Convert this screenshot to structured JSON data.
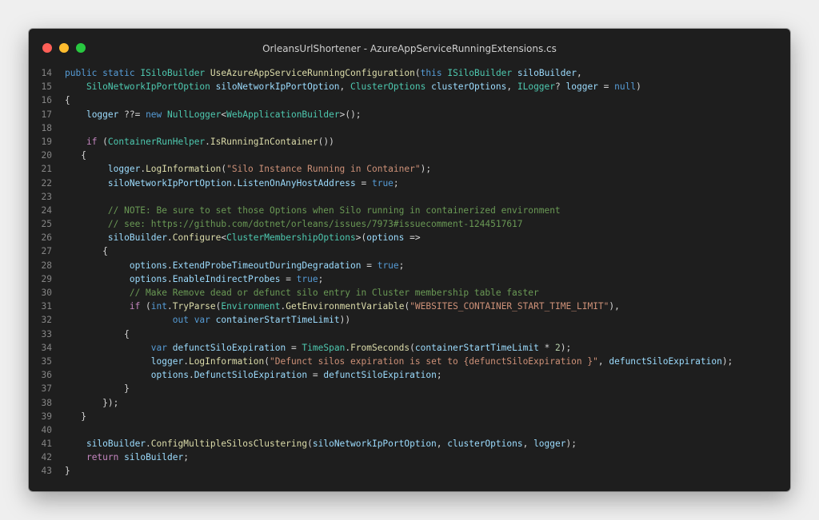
{
  "window": {
    "title": "OrleansUrlShortener - AzureAppServiceRunningExtensions.cs",
    "traffic_lights": [
      {
        "name": "close",
        "color": "#ff5f57"
      },
      {
        "name": "minimize",
        "color": "#febc2e"
      },
      {
        "name": "maximize",
        "color": "#28c840"
      }
    ]
  },
  "editor": {
    "colors": {
      "keyword": "#569cd6",
      "control": "#c586c0",
      "type": "#4ec9b0",
      "method": "#dcdcaa",
      "variable": "#9cdcfe",
      "string": "#ce9178",
      "comment": "#6a9955",
      "number": "#b5cea8",
      "plain": "#d4d4d4",
      "line_number": "#858585"
    },
    "lines": [
      {
        "num": "14",
        "tokens": [
          [
            "public",
            "keyword"
          ],
          [
            " ",
            "plain"
          ],
          [
            "static",
            "keyword"
          ],
          [
            " ",
            "plain"
          ],
          [
            "ISiloBuilder",
            "type"
          ],
          [
            " ",
            "plain"
          ],
          [
            "UseAzureAppServiceRunningConfiguration",
            "method"
          ],
          [
            "(",
            "plain"
          ],
          [
            "this",
            "keyword"
          ],
          [
            " ",
            "plain"
          ],
          [
            "ISiloBuilder",
            "type"
          ],
          [
            " ",
            "plain"
          ],
          [
            "siloBuilder",
            "variable"
          ],
          [
            ",",
            "plain"
          ]
        ]
      },
      {
        "num": "15",
        "tokens": [
          [
            "    ",
            "plain"
          ],
          [
            "SiloNetworkIpPortOption",
            "type"
          ],
          [
            " ",
            "plain"
          ],
          [
            "siloNetworkIpPortOption",
            "variable"
          ],
          [
            ", ",
            "plain"
          ],
          [
            "ClusterOptions",
            "type"
          ],
          [
            " ",
            "plain"
          ],
          [
            "clusterOptions",
            "variable"
          ],
          [
            ", ",
            "plain"
          ],
          [
            "ILogger",
            "type"
          ],
          [
            "? ",
            "plain"
          ],
          [
            "logger",
            "variable"
          ],
          [
            " = ",
            "plain"
          ],
          [
            "null",
            "keyword"
          ],
          [
            ")",
            "plain"
          ]
        ]
      },
      {
        "num": "16",
        "tokens": [
          [
            "{",
            "plain"
          ]
        ]
      },
      {
        "num": "17",
        "tokens": [
          [
            "    ",
            "plain"
          ],
          [
            "logger",
            "variable"
          ],
          [
            " ??= ",
            "plain"
          ],
          [
            "new",
            "keyword"
          ],
          [
            " ",
            "plain"
          ],
          [
            "NullLogger",
            "type"
          ],
          [
            "<",
            "plain"
          ],
          [
            "WebApplicationBuilder",
            "type"
          ],
          [
            ">();",
            "plain"
          ]
        ]
      },
      {
        "num": "18",
        "tokens": []
      },
      {
        "num": "19",
        "tokens": [
          [
            "    ",
            "plain"
          ],
          [
            "if",
            "control"
          ],
          [
            " (",
            "plain"
          ],
          [
            "ContainerRunHelper",
            "type"
          ],
          [
            ".",
            "plain"
          ],
          [
            "IsRunningInContainer",
            "method"
          ],
          [
            "())",
            "plain"
          ]
        ]
      },
      {
        "num": "20",
        "tokens": [
          [
            "   {",
            "plain"
          ]
        ]
      },
      {
        "num": "21",
        "tokens": [
          [
            "        ",
            "plain"
          ],
          [
            "logger",
            "variable"
          ],
          [
            ".",
            "plain"
          ],
          [
            "LogInformation",
            "method"
          ],
          [
            "(",
            "plain"
          ],
          [
            "\"Silo Instance Running in Container\"",
            "string"
          ],
          [
            ");",
            "plain"
          ]
        ]
      },
      {
        "num": "22",
        "tokens": [
          [
            "        ",
            "plain"
          ],
          [
            "siloNetworkIpPortOption",
            "variable"
          ],
          [
            ".",
            "plain"
          ],
          [
            "ListenOnAnyHostAddress",
            "variable"
          ],
          [
            " = ",
            "plain"
          ],
          [
            "true",
            "keyword"
          ],
          [
            ";",
            "plain"
          ]
        ]
      },
      {
        "num": "23",
        "tokens": []
      },
      {
        "num": "24",
        "tokens": [
          [
            "        ",
            "plain"
          ],
          [
            "// NOTE: Be sure to set those Options when Silo running in containerized environment",
            "comment"
          ]
        ]
      },
      {
        "num": "25",
        "tokens": [
          [
            "        ",
            "plain"
          ],
          [
            "// see: https://github.com/dotnet/orleans/issues/7973#issuecomment-1244517617",
            "comment"
          ]
        ]
      },
      {
        "num": "26",
        "tokens": [
          [
            "        ",
            "plain"
          ],
          [
            "siloBuilder",
            "variable"
          ],
          [
            ".",
            "plain"
          ],
          [
            "Configure",
            "method"
          ],
          [
            "<",
            "plain"
          ],
          [
            "ClusterMembershipOptions",
            "type"
          ],
          [
            ">(",
            "plain"
          ],
          [
            "options",
            "variable"
          ],
          [
            " =>",
            "plain"
          ]
        ]
      },
      {
        "num": "27",
        "tokens": [
          [
            "       {",
            "plain"
          ]
        ]
      },
      {
        "num": "28",
        "tokens": [
          [
            "            ",
            "plain"
          ],
          [
            "options",
            "variable"
          ],
          [
            ".",
            "plain"
          ],
          [
            "ExtendProbeTimeoutDuringDegradation",
            "variable"
          ],
          [
            " = ",
            "plain"
          ],
          [
            "true",
            "keyword"
          ],
          [
            ";",
            "plain"
          ]
        ]
      },
      {
        "num": "29",
        "tokens": [
          [
            "            ",
            "plain"
          ],
          [
            "options",
            "variable"
          ],
          [
            ".",
            "plain"
          ],
          [
            "EnableIndirectProbes",
            "variable"
          ],
          [
            " = ",
            "plain"
          ],
          [
            "true",
            "keyword"
          ],
          [
            ";",
            "plain"
          ]
        ]
      },
      {
        "num": "30",
        "tokens": [
          [
            "            ",
            "plain"
          ],
          [
            "// Make Remove dead or defunct silo entry in Cluster membership table faster",
            "comment"
          ]
        ]
      },
      {
        "num": "31",
        "tokens": [
          [
            "            ",
            "plain"
          ],
          [
            "if",
            "control"
          ],
          [
            " (",
            "plain"
          ],
          [
            "int",
            "keyword"
          ],
          [
            ".",
            "plain"
          ],
          [
            "TryParse",
            "method"
          ],
          [
            "(",
            "plain"
          ],
          [
            "Environment",
            "type"
          ],
          [
            ".",
            "plain"
          ],
          [
            "GetEnvironmentVariable",
            "method"
          ],
          [
            "(",
            "plain"
          ],
          [
            "\"WEBSITES_CONTAINER_START_TIME_LIMIT\"",
            "string"
          ],
          [
            "),",
            "plain"
          ]
        ]
      },
      {
        "num": "32",
        "tokens": [
          [
            "                    ",
            "plain"
          ],
          [
            "out",
            "keyword"
          ],
          [
            " ",
            "plain"
          ],
          [
            "var",
            "keyword"
          ],
          [
            " ",
            "plain"
          ],
          [
            "containerStartTimeLimit",
            "variable"
          ],
          [
            "))",
            "plain"
          ]
        ]
      },
      {
        "num": "33",
        "tokens": [
          [
            "           {",
            "plain"
          ]
        ]
      },
      {
        "num": "34",
        "tokens": [
          [
            "                ",
            "plain"
          ],
          [
            "var",
            "keyword"
          ],
          [
            " ",
            "plain"
          ],
          [
            "defunctSiloExpiration",
            "variable"
          ],
          [
            " = ",
            "plain"
          ],
          [
            "TimeSpan",
            "type"
          ],
          [
            ".",
            "plain"
          ],
          [
            "FromSeconds",
            "method"
          ],
          [
            "(",
            "plain"
          ],
          [
            "containerStartTimeLimit",
            "variable"
          ],
          [
            " * ",
            "plain"
          ],
          [
            "2",
            "number"
          ],
          [
            ");",
            "plain"
          ]
        ]
      },
      {
        "num": "35",
        "tokens": [
          [
            "                ",
            "plain"
          ],
          [
            "logger",
            "variable"
          ],
          [
            ".",
            "plain"
          ],
          [
            "LogInformation",
            "method"
          ],
          [
            "(",
            "plain"
          ],
          [
            "\"Defunct silos expiration is set to {defunctSiloExpiration }\"",
            "string"
          ],
          [
            ", ",
            "plain"
          ],
          [
            "defunctSiloExpiration",
            "variable"
          ],
          [
            ");",
            "plain"
          ]
        ]
      },
      {
        "num": "36",
        "tokens": [
          [
            "                ",
            "plain"
          ],
          [
            "options",
            "variable"
          ],
          [
            ".",
            "plain"
          ],
          [
            "DefunctSiloExpiration",
            "variable"
          ],
          [
            " = ",
            "plain"
          ],
          [
            "defunctSiloExpiration",
            "variable"
          ],
          [
            ";",
            "plain"
          ]
        ]
      },
      {
        "num": "37",
        "tokens": [
          [
            "           }",
            "plain"
          ]
        ]
      },
      {
        "num": "38",
        "tokens": [
          [
            "       });",
            "plain"
          ]
        ]
      },
      {
        "num": "39",
        "tokens": [
          [
            "   }",
            "plain"
          ]
        ]
      },
      {
        "num": "40",
        "tokens": []
      },
      {
        "num": "41",
        "tokens": [
          [
            "    ",
            "plain"
          ],
          [
            "siloBuilder",
            "variable"
          ],
          [
            ".",
            "plain"
          ],
          [
            "ConfigMultipleSilosClustering",
            "method"
          ],
          [
            "(",
            "plain"
          ],
          [
            "siloNetworkIpPortOption",
            "variable"
          ],
          [
            ", ",
            "plain"
          ],
          [
            "clusterOptions",
            "variable"
          ],
          [
            ", ",
            "plain"
          ],
          [
            "logger",
            "variable"
          ],
          [
            ");",
            "plain"
          ]
        ]
      },
      {
        "num": "42",
        "tokens": [
          [
            "    ",
            "plain"
          ],
          [
            "return",
            "control"
          ],
          [
            " ",
            "plain"
          ],
          [
            "siloBuilder",
            "variable"
          ],
          [
            ";",
            "plain"
          ]
        ]
      },
      {
        "num": "43",
        "tokens": [
          [
            "}",
            "plain"
          ]
        ]
      }
    ]
  }
}
